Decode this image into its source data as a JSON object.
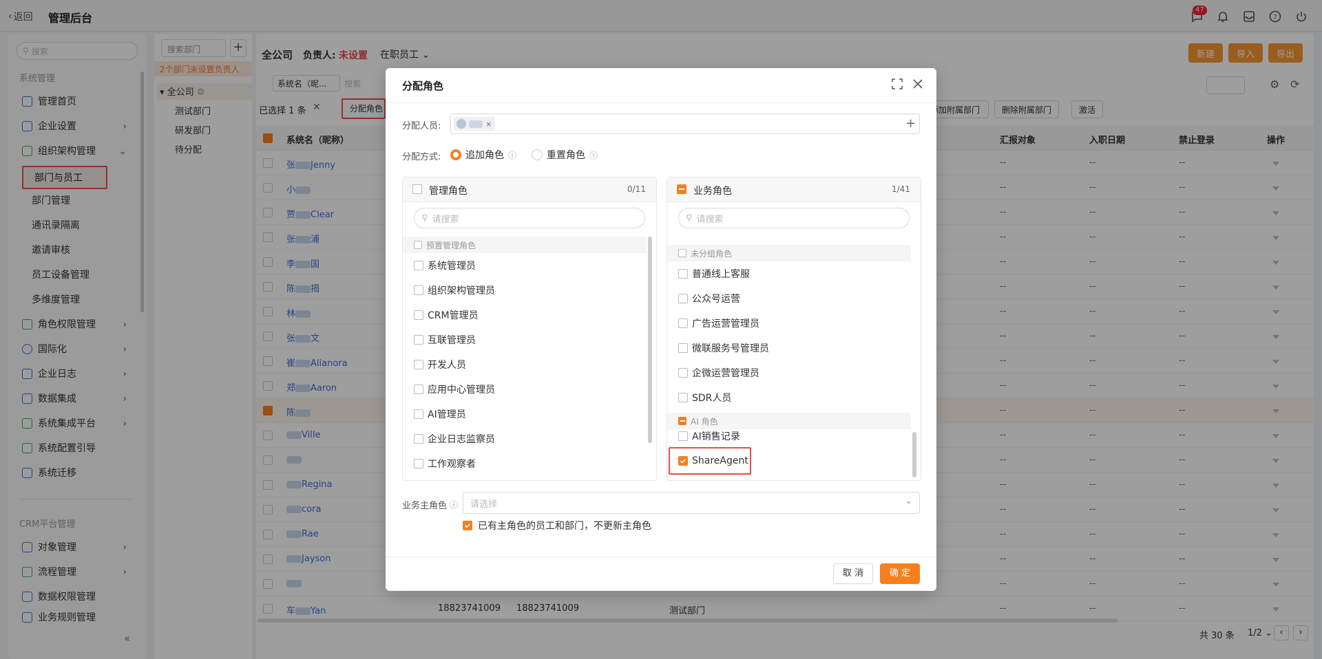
{
  "topbar": {
    "back_label": "返回",
    "title": "管理后台",
    "notif_count": "47"
  },
  "sidebar": {
    "search_placeholder": "搜索",
    "section1": "系统管理",
    "items": [
      {
        "label": "管理首页",
        "icon": "home-icon"
      },
      {
        "label": "企业设置",
        "icon": "building-icon"
      },
      {
        "label": "组织架构管理",
        "icon": "org-icon"
      },
      {
        "label": "角色权限管理",
        "icon": "role-icon"
      },
      {
        "label": "国际化",
        "icon": "globe-icon"
      },
      {
        "label": "企业日志",
        "icon": "log-icon"
      },
      {
        "label": "数据集成",
        "icon": "data-icon"
      },
      {
        "label": "系统集成平台",
        "icon": "integration-icon"
      },
      {
        "label": "系统配置引导",
        "icon": "guide-icon"
      },
      {
        "label": "系统迁移",
        "icon": "migrate-icon"
      }
    ],
    "subitems": [
      "部门与员工",
      "部门管理",
      "通讯录隔离",
      "邀请审核",
      "员工设备管理",
      "多维度管理"
    ],
    "section2": "CRM平台管理",
    "crm_items": [
      "对象管理",
      "流程管理",
      "数据权限管理",
      "业务规则管理"
    ]
  },
  "dept_panel": {
    "search_placeholder": "搜索部门",
    "warning": "2个部门未设置负责人",
    "root": "全公司",
    "children": [
      "测试部门",
      "研发部门",
      "待分配"
    ]
  },
  "main": {
    "company": "全公司",
    "owner_label": "负责人:",
    "owner_value": "未设置",
    "status_filter": "在职员工",
    "btn_new": "新建",
    "btn_import": "导入",
    "btn_export": "导出",
    "filter_field": "系统名（昵...",
    "filter_search": "搜索",
    "selected_label": "已选择",
    "selected_count": "1",
    "selected_unit": "条",
    "btn_assign_role": "分配角色",
    "btn_add_dept": "添加附属部门",
    "btn_del_dept": "删除附属部门",
    "btn_activate": "激活",
    "columns": [
      "系统名（昵称）",
      "汇报对象",
      "入职日期",
      "禁止登录",
      "操作"
    ],
    "rows": [
      {
        "name": "张",
        "suffix": "Jenny"
      },
      {
        "name": "小",
        "suffix": ""
      },
      {
        "name": "贾",
        "suffix": "Clear"
      },
      {
        "name": "张",
        "suffix": "浦"
      },
      {
        "name": "李",
        "suffix": "国"
      },
      {
        "name": "陈",
        "suffix": "揭"
      },
      {
        "name": "林",
        "suffix": ""
      },
      {
        "name": "张",
        "suffix": "文"
      },
      {
        "name": "崔",
        "suffix": "Alianora"
      },
      {
        "name": "郑",
        "suffix": "Aaron"
      },
      {
        "name": "陈",
        "suffix": ""
      },
      {
        "name": "",
        "suffix": "Ville"
      },
      {
        "name": "",
        "suffix": ""
      },
      {
        "name": "",
        "suffix": "Regina"
      },
      {
        "name": "",
        "suffix": "cora"
      },
      {
        "name": "",
        "suffix": "Rae"
      },
      {
        "name": "",
        "suffix": "Jayson"
      },
      {
        "name": "",
        "suffix": ""
      },
      {
        "name": "车",
        "suffix": "Yan"
      }
    ],
    "last_row": {
      "phone1": "18823741009",
      "phone2": "18823741009",
      "dept": "测试部门"
    },
    "dash": "--",
    "pager_total": "共 30 条",
    "pager_page": "1/2"
  },
  "modal": {
    "title": "分配角色",
    "assign_person_label": "分配人员:",
    "assign_mode_label": "分配方式:",
    "mode_append": "追加角色",
    "mode_reset": "重置角色",
    "left": {
      "title": "管理角色",
      "count": "0/11",
      "search_placeholder": "请搜索",
      "group": "预置管理角色",
      "options": [
        "系统管理员",
        "组织架构管理员",
        "CRM管理员",
        "互联管理员",
        "开发人员",
        "应用中心管理员",
        "AI管理员",
        "企业日志监察员",
        "工作观察者"
      ]
    },
    "right": {
      "title": "业务角色",
      "count": "1/41",
      "search_placeholder": "请搜索",
      "group1": "未分组角色",
      "options1": [
        "普通线上客服",
        "公众号运营",
        "广告运营管理员",
        "微联服务号管理员",
        "企微运营管理员",
        "SDR人员"
      ],
      "group2": "AI 角色",
      "options2": [
        "AI销售记录",
        "ShareAgent"
      ]
    },
    "main_role_label": "业务主角色",
    "main_role_placeholder": "请选择",
    "keep_main_role": "已有主角色的员工和部门，不更新主角色",
    "btn_cancel": "取 消",
    "btn_ok": "确 定"
  },
  "colors": {
    "accent": "#f77f1e",
    "link": "#3a6fd8",
    "danger": "#e84c4c"
  }
}
